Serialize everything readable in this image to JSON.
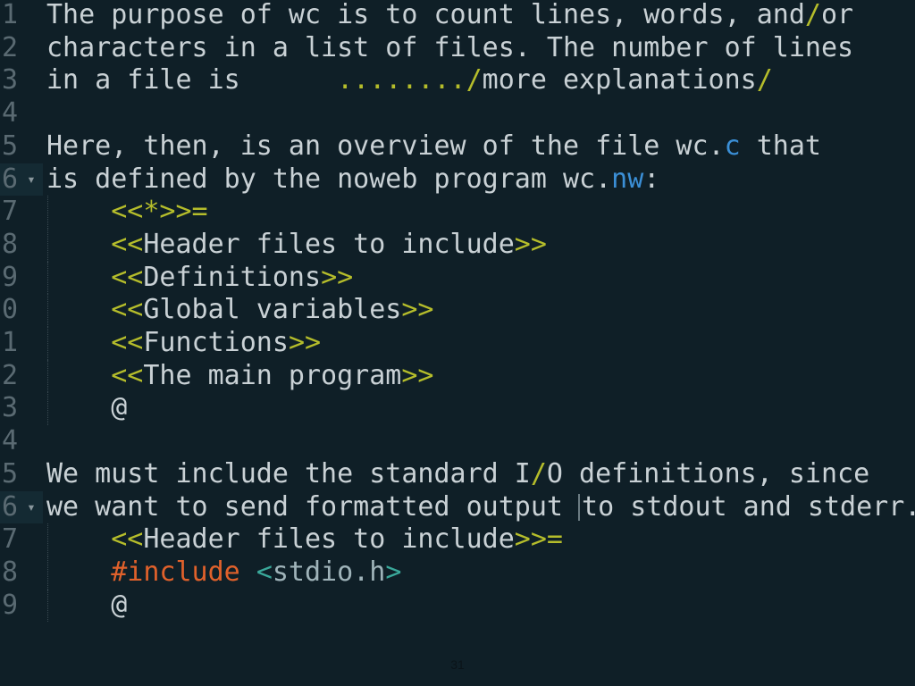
{
  "editor": {
    "lines": [
      {
        "num": "1",
        "segments": [
          [
            "The purpose of wc is to count lines, words, and",
            "t"
          ],
          [
            "/",
            "slash"
          ],
          [
            "or",
            "t"
          ]
        ]
      },
      {
        "num": "2",
        "segments": [
          [
            "characters in a list of files. The number of lines",
            "t"
          ]
        ]
      },
      {
        "num": "3",
        "segments": [
          [
            "in a file is      ",
            "t"
          ],
          [
            "........",
            "dots"
          ],
          [
            "/",
            "slash"
          ],
          [
            "more explanations",
            "t"
          ],
          [
            "/",
            "slash"
          ]
        ]
      },
      {
        "num": "4",
        "segments": []
      },
      {
        "num": "5",
        "segments": [
          [
            "Here, then, is an overview of the file wc.",
            "t"
          ],
          [
            "c",
            "blue"
          ],
          [
            " that",
            "t"
          ]
        ]
      },
      {
        "num": "6",
        "fold": true,
        "segments": [
          [
            "is defined by the noweb program wc.",
            "t"
          ],
          [
            "nw",
            "blue"
          ],
          [
            ":",
            "t"
          ]
        ]
      },
      {
        "num": "7",
        "indent": true,
        "segments": [
          [
            "    ",
            "t"
          ],
          [
            "<<*>>=",
            "y"
          ]
        ]
      },
      {
        "num": "8",
        "indent": true,
        "segments": [
          [
            "    ",
            "t"
          ],
          [
            "<<",
            "y"
          ],
          [
            "Header files to include",
            "t"
          ],
          [
            ">>",
            "y"
          ]
        ]
      },
      {
        "num": "9",
        "indent": true,
        "segments": [
          [
            "    ",
            "t"
          ],
          [
            "<<",
            "y"
          ],
          [
            "Definitions",
            "t"
          ],
          [
            ">>",
            "y"
          ]
        ]
      },
      {
        "num": "0",
        "indent": true,
        "segments": [
          [
            "    ",
            "t"
          ],
          [
            "<<",
            "y"
          ],
          [
            "Global variables",
            "t"
          ],
          [
            ">>",
            "y"
          ]
        ]
      },
      {
        "num": "1",
        "indent": true,
        "segments": [
          [
            "    ",
            "t"
          ],
          [
            "<<",
            "y"
          ],
          [
            "Functions",
            "t"
          ],
          [
            ">>",
            "y"
          ]
        ]
      },
      {
        "num": "2",
        "indent": true,
        "segments": [
          [
            "    ",
            "t"
          ],
          [
            "<<",
            "y"
          ],
          [
            "The main program",
            "t"
          ],
          [
            ">>",
            "y"
          ]
        ]
      },
      {
        "num": "3",
        "indent": true,
        "segments": [
          [
            "    @",
            "t"
          ]
        ]
      },
      {
        "num": "4",
        "segments": []
      },
      {
        "num": "5",
        "segments": [
          [
            "We must include the standard I",
            "t"
          ],
          [
            "/",
            "slash"
          ],
          [
            "O definitions, since",
            "t"
          ]
        ]
      },
      {
        "num": "6",
        "fold": true,
        "segments": [
          [
            "we want to send formatted output ",
            "t"
          ],
          [
            "|",
            "cursor"
          ],
          [
            "to stdout and stderr.",
            "t"
          ]
        ]
      },
      {
        "num": "7",
        "indent": true,
        "segments": [
          [
            "    ",
            "t"
          ],
          [
            "<<",
            "y"
          ],
          [
            "Header files to include",
            "t"
          ],
          [
            ">>=",
            "y"
          ]
        ]
      },
      {
        "num": "8",
        "indent": true,
        "segments": [
          [
            "    ",
            "t"
          ],
          [
            "#include",
            "include"
          ],
          [
            " ",
            "t"
          ],
          [
            "<",
            "hdr"
          ],
          [
            "stdio.h",
            "hdrname"
          ],
          [
            ">",
            "hdr"
          ]
        ]
      },
      {
        "num": "9",
        "indent": true,
        "segments": [
          [
            "    @",
            "t"
          ]
        ]
      }
    ]
  },
  "page": {
    "number": "31"
  },
  "colors": {
    "background": "#0f1f27",
    "text": "#c9d1d5",
    "chunk_marker": "#b5bd2b",
    "keyword_blue": "#3b8fd6",
    "include": "#e0612b",
    "header_bracket": "#3aa89a"
  }
}
